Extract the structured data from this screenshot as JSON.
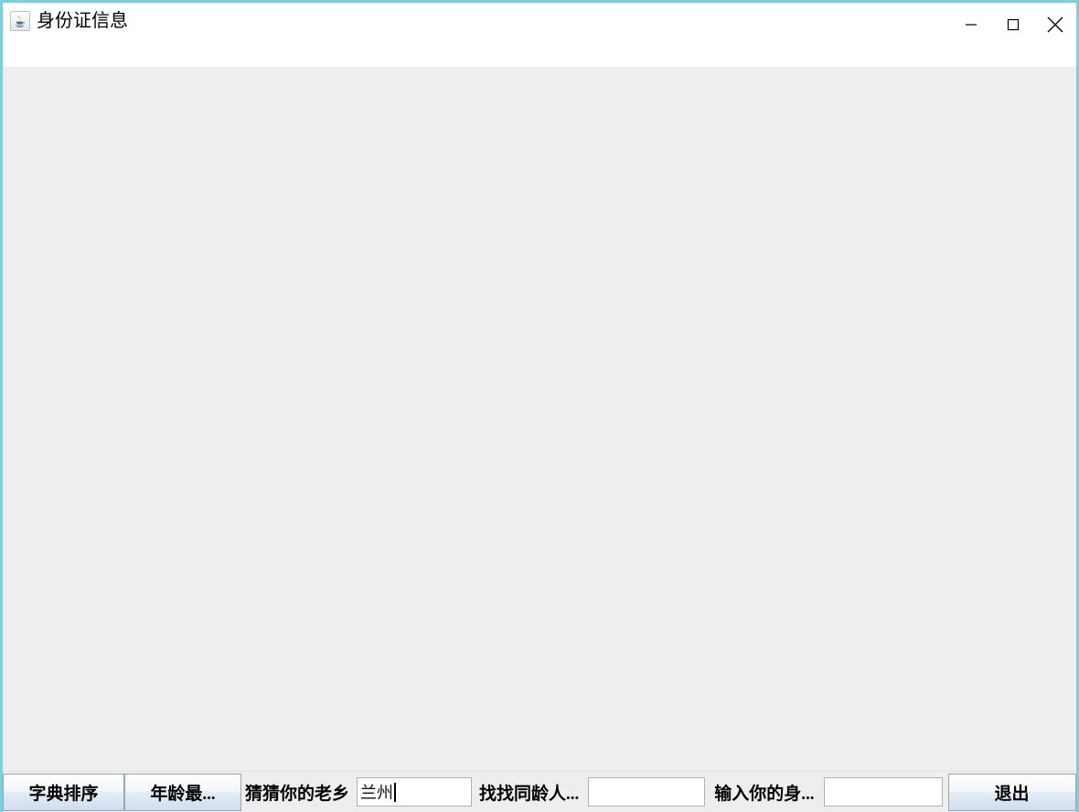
{
  "window": {
    "title": "身份证信息",
    "icon": "java-coffee-cup-icon",
    "border_color": "#7ccfdb",
    "titlebar_bg": "#ffffff",
    "content_bg": "#eeeeee",
    "controls": {
      "minimize": "minimize-icon",
      "maximize": "maximize-icon",
      "close": "close-icon"
    }
  },
  "toolbar": {
    "sort_button_label": "字典排序",
    "age_button_label": "年龄最...",
    "hometown_label": "猜猜你的老乡",
    "hometown_field_value": "兰州",
    "hometown_field_placeholder": "",
    "same_age_label": "找找同龄人...",
    "same_age_field_value": "",
    "same_age_field_placeholder": "",
    "id_label": "输入你的身...",
    "id_field_value": "",
    "id_field_placeholder": "",
    "quit_button_label": "退出"
  }
}
